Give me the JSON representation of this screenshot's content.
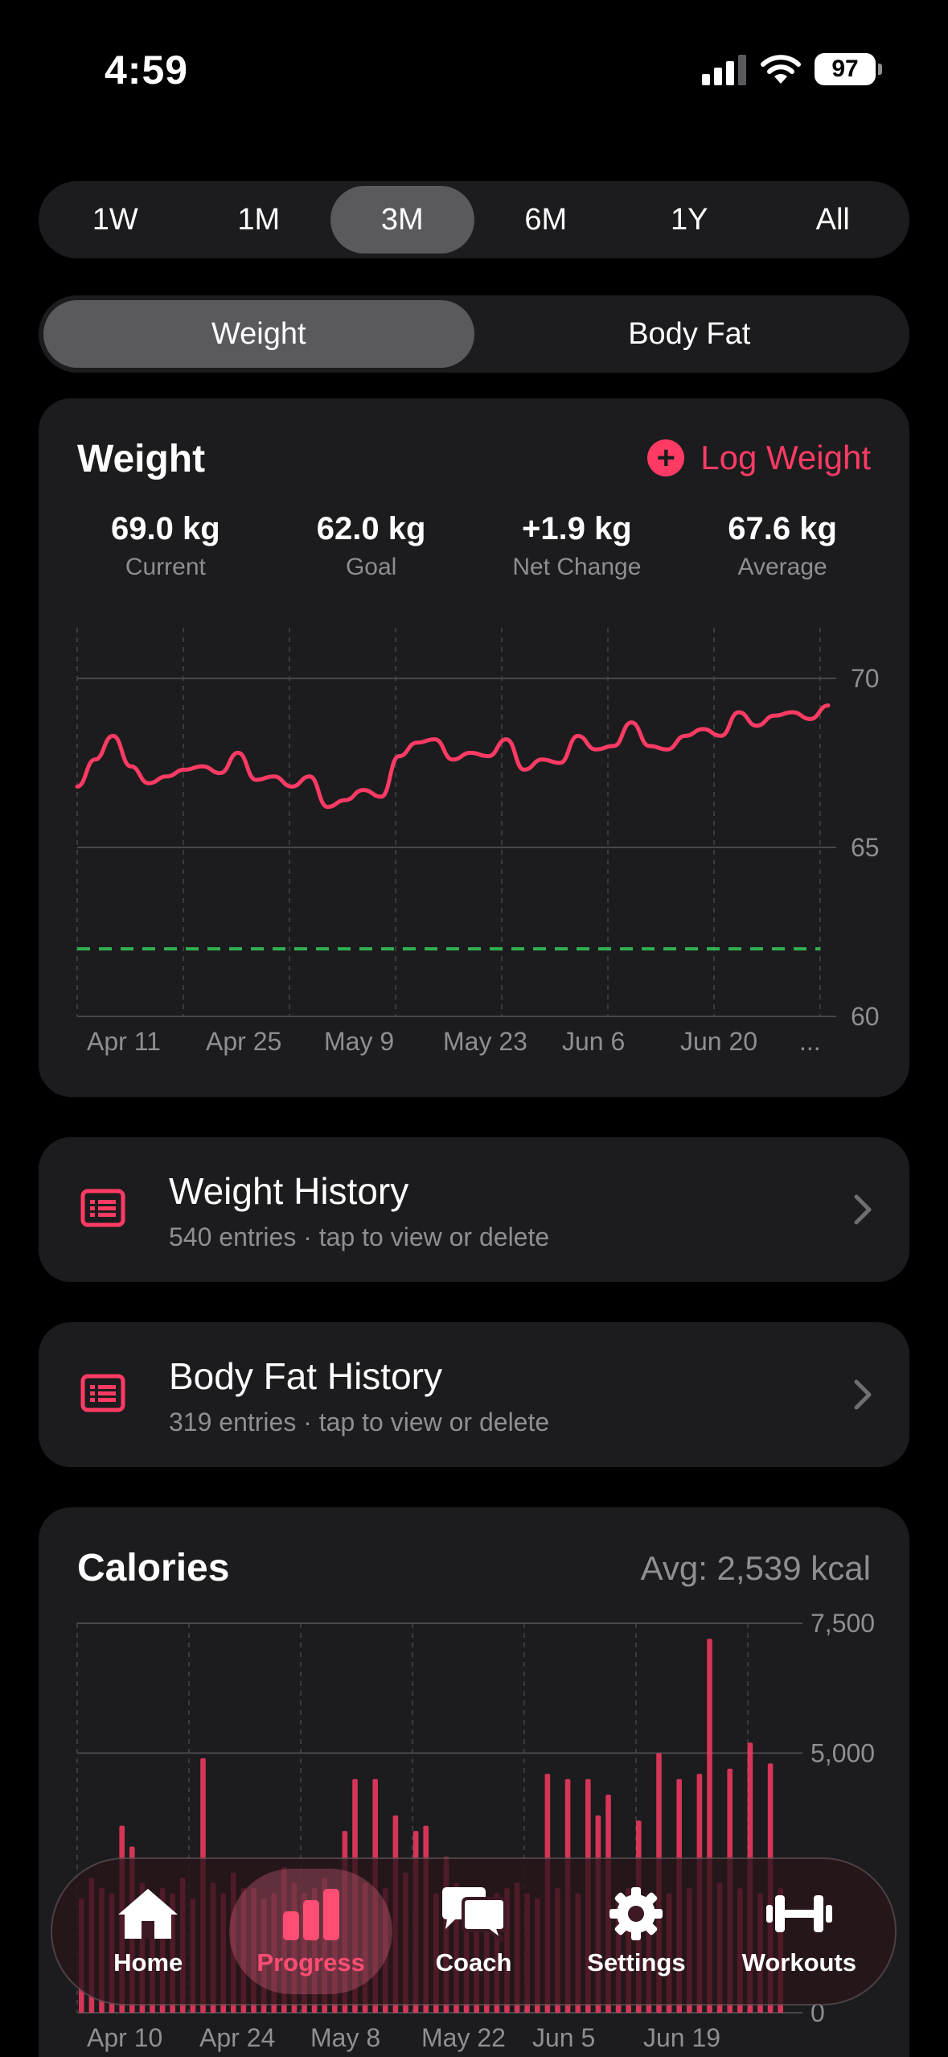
{
  "status": {
    "time": "4:59",
    "battery": "97"
  },
  "range_tabs": [
    {
      "label": "1W",
      "active": false
    },
    {
      "label": "1M",
      "active": false
    },
    {
      "label": "3M",
      "active": true
    },
    {
      "label": "6M",
      "active": false
    },
    {
      "label": "1Y",
      "active": false
    },
    {
      "label": "All",
      "active": false
    }
  ],
  "metric_tabs": [
    {
      "label": "Weight",
      "active": true
    },
    {
      "label": "Body Fat",
      "active": false
    }
  ],
  "weight_card": {
    "title": "Weight",
    "log_label": "Log Weight",
    "stats": [
      {
        "value": "69.0 kg",
        "label": "Current"
      },
      {
        "value": "62.0 kg",
        "label": "Goal"
      },
      {
        "value": "+1.9 kg",
        "label": "Net Change"
      },
      {
        "value": "67.6 kg",
        "label": "Average"
      }
    ]
  },
  "history": [
    {
      "title": "Weight History",
      "subtitle": "540 entries · tap to view or delete"
    },
    {
      "title": "Body Fat History",
      "subtitle": "319 entries · tap to view or delete"
    }
  ],
  "calories_card": {
    "title": "Calories",
    "avg": "Avg: 2,539 kcal"
  },
  "tabbar": [
    {
      "label": "Home",
      "icon": "house-icon",
      "active": false
    },
    {
      "label": "Progress",
      "icon": "bar-chart-icon",
      "active": true
    },
    {
      "label": "Coach",
      "icon": "chat-bubbles-icon",
      "active": false
    },
    {
      "label": "Settings",
      "icon": "gear-icon",
      "active": false
    },
    {
      "label": "Workouts",
      "icon": "dumbbell-icon",
      "active": false
    }
  ],
  "colors": {
    "accent": "#ff3b64",
    "goal": "#30b050",
    "card": "#1c1c1e"
  },
  "chart_data": [
    {
      "type": "line",
      "x_ticks": [
        "Apr 11",
        "Apr 25",
        "May 9",
        "May 23",
        "Jun 6",
        "Jun 20",
        "..."
      ],
      "y_ticks": [
        "70",
        "65",
        "60"
      ],
      "ylim": [
        60,
        71.5
      ],
      "goal": 62.0,
      "series": [
        {
          "values": [
            66.8,
            67.6,
            68.3,
            67.4,
            66.9,
            67.1,
            67.3,
            67.4,
            67.2,
            67.8,
            67.0,
            67.1,
            66.8,
            67.1,
            66.2,
            66.4,
            66.7,
            66.5,
            67.7,
            68.1,
            68.2,
            67.6,
            67.8,
            67.7,
            68.2,
            67.3,
            67.6,
            67.5,
            68.3,
            67.9,
            68.0,
            68.7,
            68.0,
            67.9,
            68.3,
            68.5,
            68.3,
            69.0,
            68.6,
            68.9,
            69.0,
            68.8,
            69.2
          ]
        }
      ]
    },
    {
      "type": "bar",
      "title": "Calories",
      "x_ticks": [
        "Apr 10",
        "Apr 24",
        "May 8",
        "May 22",
        "Jun 5",
        "Jun 19"
      ],
      "y_ticks": [
        "7,500",
        "5,000",
        "0"
      ],
      "ylim": [
        0,
        7500
      ],
      "values": [
        2200,
        2600,
        2400,
        2300,
        3600,
        3200,
        2500,
        2200,
        2400,
        2300,
        2600,
        2200,
        4900,
        2500,
        2300,
        2700,
        2400,
        2400,
        2200,
        2300,
        2800,
        2500,
        2300,
        2400,
        2600,
        2200,
        3500,
        4500,
        2500,
        4500,
        2400,
        3800,
        2700,
        3500,
        3600,
        2300,
        3000,
        2500,
        2300,
        2400,
        2200,
        2300,
        2400,
        2500,
        2300,
        2200,
        4600,
        2400,
        4500,
        2300,
        4500,
        3800,
        4200,
        2300,
        2400,
        3700,
        2300,
        5000,
        2300,
        4500,
        2400,
        4600,
        7200,
        2500,
        4700,
        2400,
        5200,
        2300,
        4800,
        2400
      ]
    }
  ]
}
